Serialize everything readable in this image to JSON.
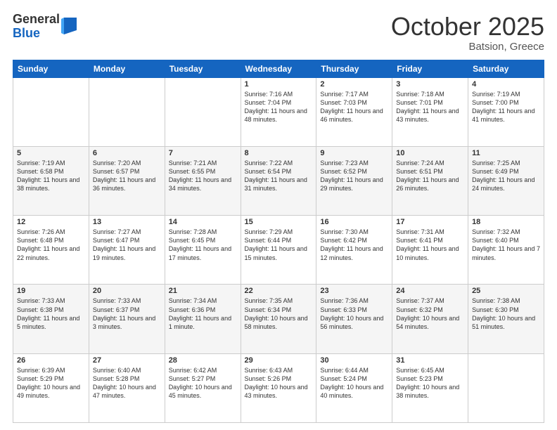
{
  "logo": {
    "general": "General",
    "blue": "Blue"
  },
  "title": "October 2025",
  "location": "Batsion, Greece",
  "days_of_week": [
    "Sunday",
    "Monday",
    "Tuesday",
    "Wednesday",
    "Thursday",
    "Friday",
    "Saturday"
  ],
  "weeks": [
    [
      {
        "day": "",
        "info": ""
      },
      {
        "day": "",
        "info": ""
      },
      {
        "day": "",
        "info": ""
      },
      {
        "day": "1",
        "info": "Sunrise: 7:16 AM\nSunset: 7:04 PM\nDaylight: 11 hours\nand 48 minutes."
      },
      {
        "day": "2",
        "info": "Sunrise: 7:17 AM\nSunset: 7:03 PM\nDaylight: 11 hours\nand 46 minutes."
      },
      {
        "day": "3",
        "info": "Sunrise: 7:18 AM\nSunset: 7:01 PM\nDaylight: 11 hours\nand 43 minutes."
      },
      {
        "day": "4",
        "info": "Sunrise: 7:19 AM\nSunset: 7:00 PM\nDaylight: 11 hours\nand 41 minutes."
      }
    ],
    [
      {
        "day": "5",
        "info": "Sunrise: 7:19 AM\nSunset: 6:58 PM\nDaylight: 11 hours\nand 38 minutes."
      },
      {
        "day": "6",
        "info": "Sunrise: 7:20 AM\nSunset: 6:57 PM\nDaylight: 11 hours\nand 36 minutes."
      },
      {
        "day": "7",
        "info": "Sunrise: 7:21 AM\nSunset: 6:55 PM\nDaylight: 11 hours\nand 34 minutes."
      },
      {
        "day": "8",
        "info": "Sunrise: 7:22 AM\nSunset: 6:54 PM\nDaylight: 11 hours\nand 31 minutes."
      },
      {
        "day": "9",
        "info": "Sunrise: 7:23 AM\nSunset: 6:52 PM\nDaylight: 11 hours\nand 29 minutes."
      },
      {
        "day": "10",
        "info": "Sunrise: 7:24 AM\nSunset: 6:51 PM\nDaylight: 11 hours\nand 26 minutes."
      },
      {
        "day": "11",
        "info": "Sunrise: 7:25 AM\nSunset: 6:49 PM\nDaylight: 11 hours\nand 24 minutes."
      }
    ],
    [
      {
        "day": "12",
        "info": "Sunrise: 7:26 AM\nSunset: 6:48 PM\nDaylight: 11 hours\nand 22 minutes."
      },
      {
        "day": "13",
        "info": "Sunrise: 7:27 AM\nSunset: 6:47 PM\nDaylight: 11 hours\nand 19 minutes."
      },
      {
        "day": "14",
        "info": "Sunrise: 7:28 AM\nSunset: 6:45 PM\nDaylight: 11 hours\nand 17 minutes."
      },
      {
        "day": "15",
        "info": "Sunrise: 7:29 AM\nSunset: 6:44 PM\nDaylight: 11 hours\nand 15 minutes."
      },
      {
        "day": "16",
        "info": "Sunrise: 7:30 AM\nSunset: 6:42 PM\nDaylight: 11 hours\nand 12 minutes."
      },
      {
        "day": "17",
        "info": "Sunrise: 7:31 AM\nSunset: 6:41 PM\nDaylight: 11 hours\nand 10 minutes."
      },
      {
        "day": "18",
        "info": "Sunrise: 7:32 AM\nSunset: 6:40 PM\nDaylight: 11 hours\nand 7 minutes."
      }
    ],
    [
      {
        "day": "19",
        "info": "Sunrise: 7:33 AM\nSunset: 6:38 PM\nDaylight: 11 hours\nand 5 minutes."
      },
      {
        "day": "20",
        "info": "Sunrise: 7:33 AM\nSunset: 6:37 PM\nDaylight: 11 hours\nand 3 minutes."
      },
      {
        "day": "21",
        "info": "Sunrise: 7:34 AM\nSunset: 6:36 PM\nDaylight: 11 hours\nand 1 minute."
      },
      {
        "day": "22",
        "info": "Sunrise: 7:35 AM\nSunset: 6:34 PM\nDaylight: 10 hours\nand 58 minutes."
      },
      {
        "day": "23",
        "info": "Sunrise: 7:36 AM\nSunset: 6:33 PM\nDaylight: 10 hours\nand 56 minutes."
      },
      {
        "day": "24",
        "info": "Sunrise: 7:37 AM\nSunset: 6:32 PM\nDaylight: 10 hours\nand 54 minutes."
      },
      {
        "day": "25",
        "info": "Sunrise: 7:38 AM\nSunset: 6:30 PM\nDaylight: 10 hours\nand 51 minutes."
      }
    ],
    [
      {
        "day": "26",
        "info": "Sunrise: 6:39 AM\nSunset: 5:29 PM\nDaylight: 10 hours\nand 49 minutes."
      },
      {
        "day": "27",
        "info": "Sunrise: 6:40 AM\nSunset: 5:28 PM\nDaylight: 10 hours\nand 47 minutes."
      },
      {
        "day": "28",
        "info": "Sunrise: 6:42 AM\nSunset: 5:27 PM\nDaylight: 10 hours\nand 45 minutes."
      },
      {
        "day": "29",
        "info": "Sunrise: 6:43 AM\nSunset: 5:26 PM\nDaylight: 10 hours\nand 43 minutes."
      },
      {
        "day": "30",
        "info": "Sunrise: 6:44 AM\nSunset: 5:24 PM\nDaylight: 10 hours\nand 40 minutes."
      },
      {
        "day": "31",
        "info": "Sunrise: 6:45 AM\nSunset: 5:23 PM\nDaylight: 10 hours\nand 38 minutes."
      },
      {
        "day": "",
        "info": ""
      }
    ]
  ]
}
